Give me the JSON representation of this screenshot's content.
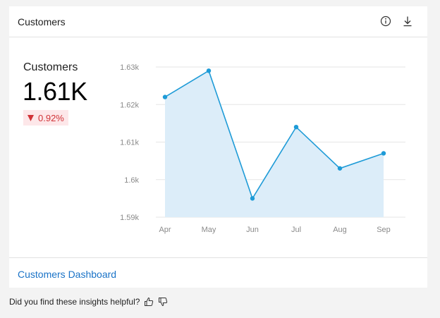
{
  "card": {
    "title": "Customers",
    "icons": {
      "info": "info-icon",
      "download": "download-icon"
    }
  },
  "metric": {
    "label": "Customers",
    "value": "1.61K",
    "delta": "0.92%",
    "delta_direction": "down",
    "delta_color": "#d13438"
  },
  "chart_data": {
    "type": "area",
    "categories": [
      "Apr",
      "May",
      "Jun",
      "Jul",
      "Aug",
      "Sep"
    ],
    "values": [
      1622,
      1629,
      1595,
      1614,
      1603,
      1607
    ],
    "ylim": [
      1590,
      1630
    ],
    "yticks": [
      1590,
      1600,
      1610,
      1620,
      1630
    ],
    "ytick_labels": [
      "1.59k",
      "1.6k",
      "1.61k",
      "1.62k",
      "1.63k"
    ],
    "title": "",
    "xlabel": "",
    "ylabel": "",
    "grid": true,
    "line_color": "#1e9bd7",
    "fill_color": "#dcedf9"
  },
  "footer": {
    "link_label": "Customers Dashboard"
  },
  "feedback": {
    "question": "Did you find these insights helpful?",
    "icons": {
      "up": "thumbs-up-icon",
      "down": "thumbs-down-icon"
    }
  }
}
